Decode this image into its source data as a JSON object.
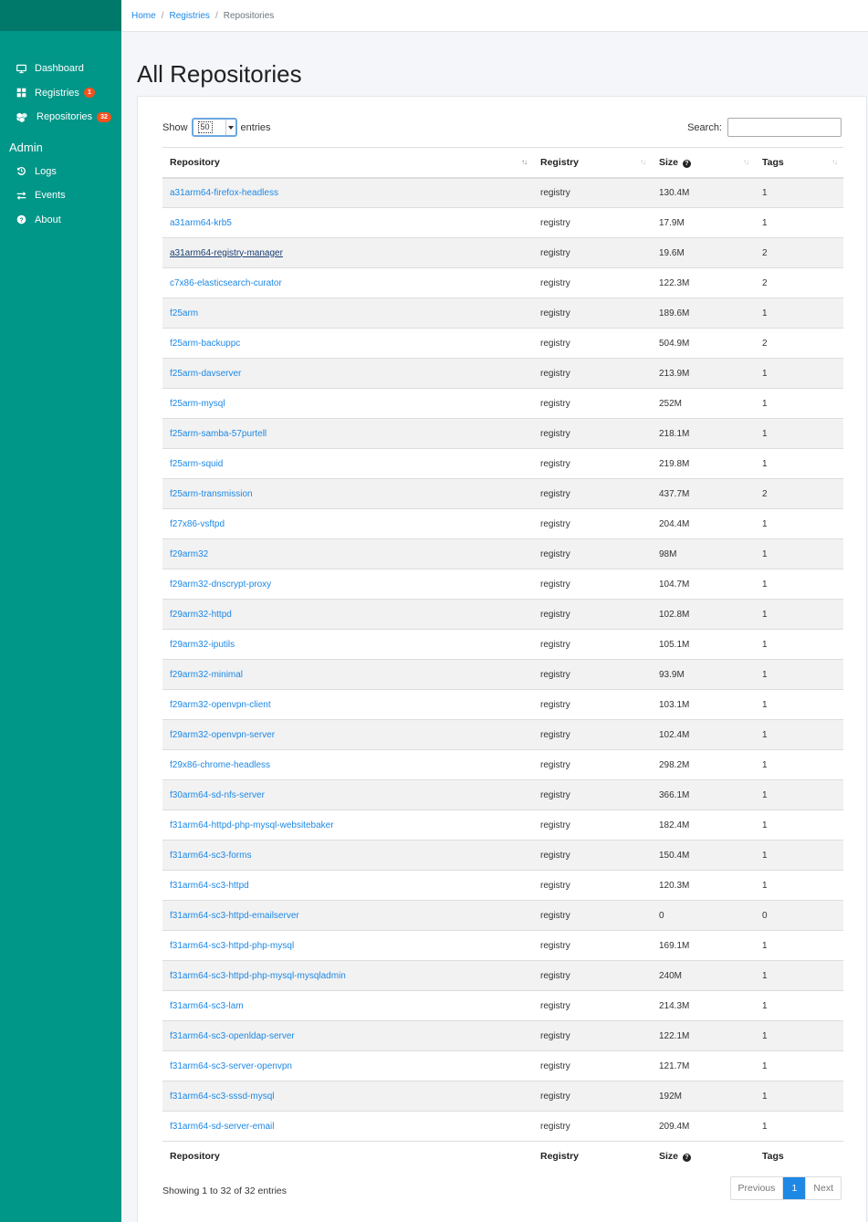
{
  "sidebar": {
    "main_items": [
      {
        "label": "Dashboard",
        "icon": "monitor-icon",
        "badge": ""
      },
      {
        "label": "Registries",
        "icon": "grid-icon",
        "badge": "1"
      },
      {
        "label": "Repositories",
        "icon": "cubes-icon",
        "badge": "32"
      }
    ],
    "admin_title": "Admin",
    "admin_items": [
      {
        "label": "Logs",
        "icon": "history-icon"
      },
      {
        "label": "Events",
        "icon": "exchange-icon"
      },
      {
        "label": "About",
        "icon": "question-circle-icon"
      }
    ],
    "badge_color": "#f4511e",
    "color": "#009688"
  },
  "breadcrumb": {
    "home": "Home",
    "registries": "Registries",
    "current": "Repositories",
    "separator": "/"
  },
  "page": {
    "title": "All Repositories"
  },
  "controls": {
    "show_label": "Show",
    "page_size": "50",
    "entries_label": "entries",
    "search_label": "Search:",
    "search_value": ""
  },
  "table": {
    "columns": [
      "Repository",
      "Registry",
      "Size",
      "Tags"
    ],
    "rows": [
      {
        "repository": "a31arm64-firefox-headless",
        "registry": "registry",
        "size": "130.4M",
        "tags": "1"
      },
      {
        "repository": "a31arm64-krb5",
        "registry": "registry",
        "size": "17.9M",
        "tags": "1"
      },
      {
        "repository": "a31arm64-registry-manager",
        "registry": "registry",
        "size": "19.6M",
        "tags": "2"
      },
      {
        "repository": "c7x86-elasticsearch-curator",
        "registry": "registry",
        "size": "122.3M",
        "tags": "2"
      },
      {
        "repository": "f25arm",
        "registry": "registry",
        "size": "189.6M",
        "tags": "1"
      },
      {
        "repository": "f25arm-backuppc",
        "registry": "registry",
        "size": "504.9M",
        "tags": "2"
      },
      {
        "repository": "f25arm-davserver",
        "registry": "registry",
        "size": "213.9M",
        "tags": "1"
      },
      {
        "repository": "f25arm-mysql",
        "registry": "registry",
        "size": "252M",
        "tags": "1"
      },
      {
        "repository": "f25arm-samba-57purtell",
        "registry": "registry",
        "size": "218.1M",
        "tags": "1"
      },
      {
        "repository": "f25arm-squid",
        "registry": "registry",
        "size": "219.8M",
        "tags": "1"
      },
      {
        "repository": "f25arm-transmission",
        "registry": "registry",
        "size": "437.7M",
        "tags": "2"
      },
      {
        "repository": "f27x86-vsftpd",
        "registry": "registry",
        "size": "204.4M",
        "tags": "1"
      },
      {
        "repository": "f29arm32",
        "registry": "registry",
        "size": "98M",
        "tags": "1"
      },
      {
        "repository": "f29arm32-dnscrypt-proxy",
        "registry": "registry",
        "size": "104.7M",
        "tags": "1"
      },
      {
        "repository": "f29arm32-httpd",
        "registry": "registry",
        "size": "102.8M",
        "tags": "1"
      },
      {
        "repository": "f29arm32-iputils",
        "registry": "registry",
        "size": "105.1M",
        "tags": "1"
      },
      {
        "repository": "f29arm32-minimal",
        "registry": "registry",
        "size": "93.9M",
        "tags": "1"
      },
      {
        "repository": "f29arm32-openvpn-client",
        "registry": "registry",
        "size": "103.1M",
        "tags": "1"
      },
      {
        "repository": "f29arm32-openvpn-server",
        "registry": "registry",
        "size": "102.4M",
        "tags": "1"
      },
      {
        "repository": "f29x86-chrome-headless",
        "registry": "registry",
        "size": "298.2M",
        "tags": "1"
      },
      {
        "repository": "f30arm64-sd-nfs-server",
        "registry": "registry",
        "size": "366.1M",
        "tags": "1"
      },
      {
        "repository": "f31arm64-httpd-php-mysql-websitebaker",
        "registry": "registry",
        "size": "182.4M",
        "tags": "1"
      },
      {
        "repository": "f31arm64-sc3-forms",
        "registry": "registry",
        "size": "150.4M",
        "tags": "1"
      },
      {
        "repository": "f31arm64-sc3-httpd",
        "registry": "registry",
        "size": "120.3M",
        "tags": "1"
      },
      {
        "repository": "f31arm64-sc3-httpd-emailserver",
        "registry": "registry",
        "size": "0",
        "tags": "0"
      },
      {
        "repository": "f31arm64-sc3-httpd-php-mysql",
        "registry": "registry",
        "size": "169.1M",
        "tags": "1"
      },
      {
        "repository": "f31arm64-sc3-httpd-php-mysql-mysqladmin",
        "registry": "registry",
        "size": "240M",
        "tags": "1"
      },
      {
        "repository": "f31arm64-sc3-lam",
        "registry": "registry",
        "size": "214.3M",
        "tags": "1"
      },
      {
        "repository": "f31arm64-sc3-openldap-server",
        "registry": "registry",
        "size": "122.1M",
        "tags": "1"
      },
      {
        "repository": "f31arm64-sc3-server-openvpn",
        "registry": "registry",
        "size": "121.7M",
        "tags": "1"
      },
      {
        "repository": "f31arm64-sc3-sssd-mysql",
        "registry": "registry",
        "size": "192M",
        "tags": "1"
      },
      {
        "repository": "f31arm64-sd-server-email",
        "registry": "registry",
        "size": "209.4M",
        "tags": "1"
      }
    ],
    "visited_row": 2
  },
  "footer": {
    "info": "Showing 1 to 32 of 32 entries",
    "prev": "Previous",
    "current_page": "1",
    "next": "Next"
  }
}
